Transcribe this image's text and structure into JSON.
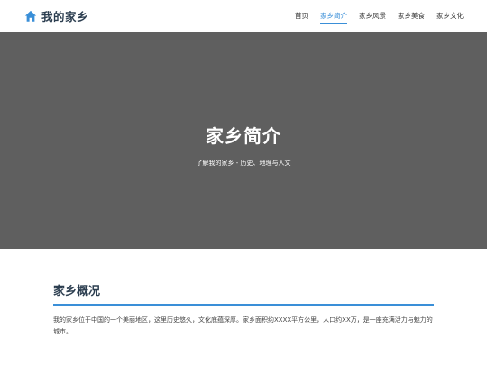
{
  "header": {
    "brand_icon": "home-icon",
    "brand_title": "我的家乡",
    "accent_color": "#3a8fd8",
    "nav": [
      {
        "label": "首页",
        "active": false
      },
      {
        "label": "家乡简介",
        "active": true
      },
      {
        "label": "家乡风景",
        "active": false
      },
      {
        "label": "家乡美食",
        "active": false
      },
      {
        "label": "家乡文化",
        "active": false
      }
    ]
  },
  "hero": {
    "title": "家乡简介",
    "subtitle": "了解我的家乡 - 历史、地理与人文",
    "background_color": "#5f5f5f"
  },
  "overview": {
    "title": "家乡概况",
    "text": "我的家乡位于中国的一个美丽地区，这里历史悠久，文化底蕴深厚。家乡面积约XXXX平方公里，人口约XX万，是一座充满活力与魅力的城市。"
  }
}
